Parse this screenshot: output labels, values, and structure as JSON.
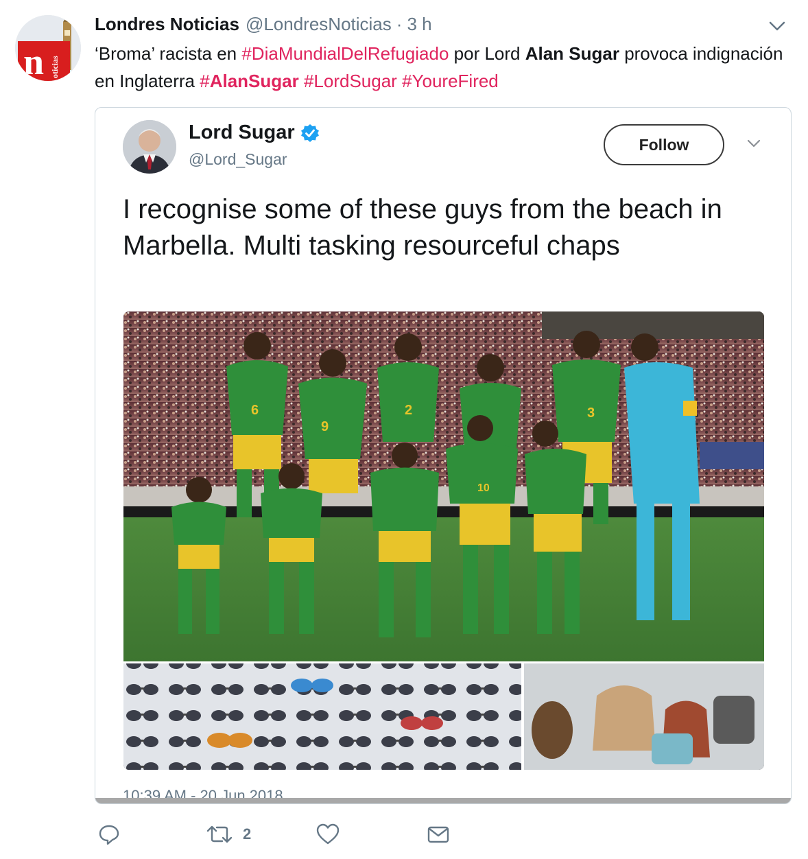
{
  "tweet": {
    "display_name": "Londres Noticias",
    "handle": "@LondresNoticias",
    "separator": "·",
    "time": "3 h",
    "avatar_icon": "noticias-logo-icon",
    "avatar_logo_text": "n",
    "avatar_logo_subtext": "oticias",
    "text": {
      "part1": "‘Broma’ racista en ",
      "hashtag1": "#DiaMundialDelRefugiado",
      "part2": " por Lord ",
      "bold1": "Alan Sugar",
      "part3": " provoca indignación en Inglaterra ",
      "hashtag2_prefix": "#",
      "hashtag2_bold": "AlanSugar",
      "space1": " ",
      "hashtag3": "#LordSugar",
      "space2": " ",
      "hashtag4": "#YoureFired"
    },
    "caret_icon": "chevron-down-icon"
  },
  "quoted_image": {
    "name": "Lord Sugar",
    "verified_icon": "verified-badge-icon",
    "handle": "@Lord_Sugar",
    "follow_label": "Follow",
    "caret_icon": "chevron-down-icon",
    "text": "I recognise some of these guys from the beach in Marbella. Multi tasking resourceful chaps",
    "timestamp": "10:39 AM - 20 Jun 2018",
    "jersey_numbers": [
      "6",
      "9",
      "2",
      "3",
      "10"
    ]
  },
  "actions": {
    "reply_icon": "reply-icon",
    "retweet_icon": "retweet-icon",
    "retweet_count": "2",
    "like_icon": "heart-icon",
    "dm_icon": "envelope-icon"
  },
  "colors": {
    "hashtag": "#e0245e",
    "secondary_text": "#657786",
    "verified": "#1da1f2",
    "jersey_green": "#2f8f3a",
    "shorts_yellow": "#e8c42a",
    "keeper_blue": "#3cb6d8"
  }
}
